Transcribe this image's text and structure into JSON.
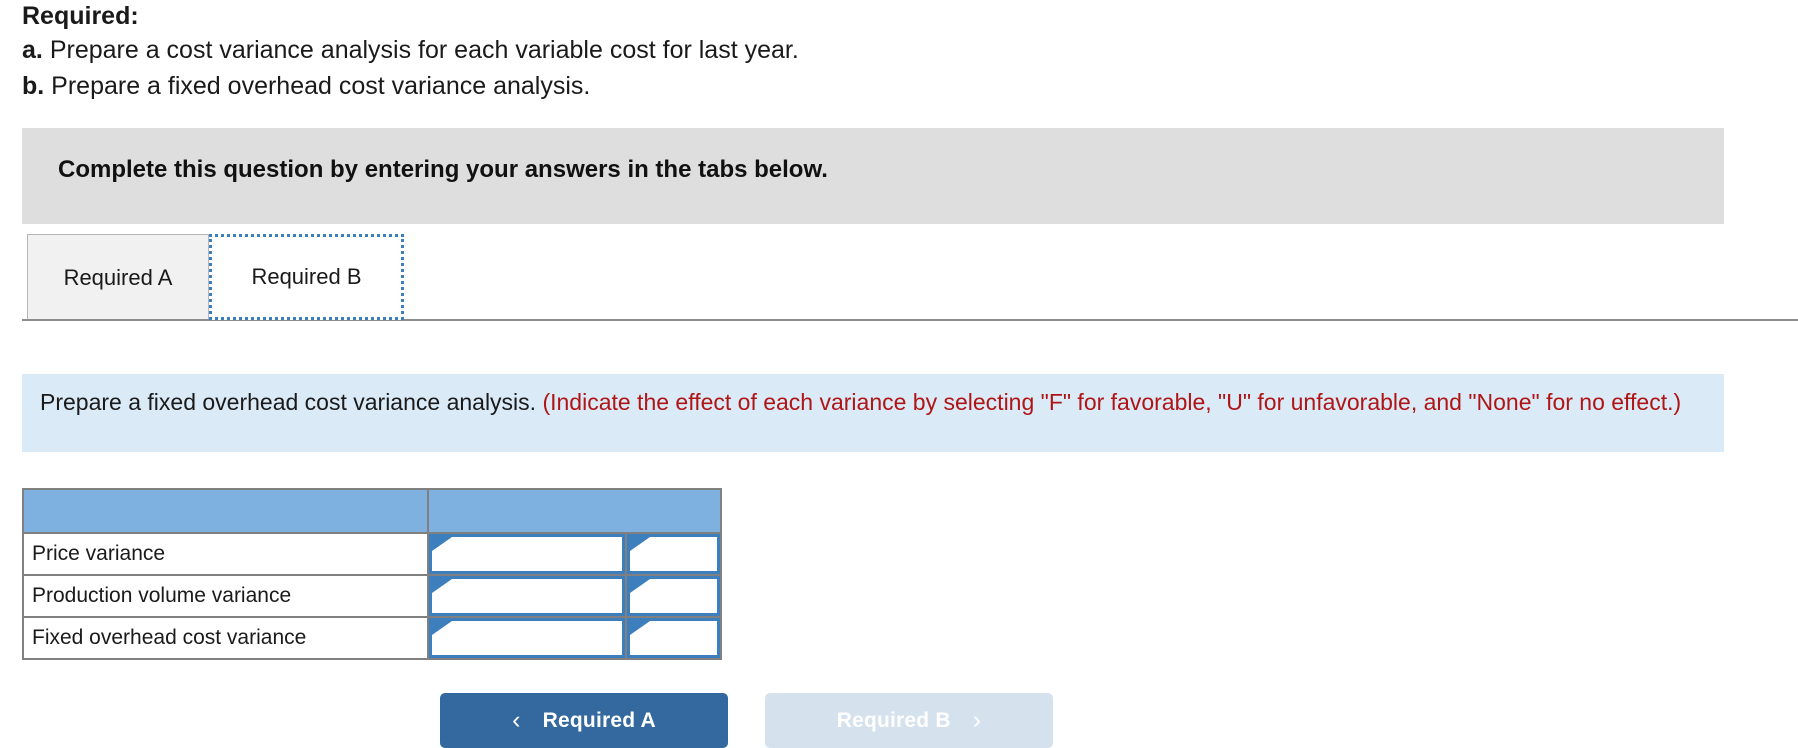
{
  "required": {
    "title": "Required:",
    "items": [
      {
        "label": "a.",
        "text": "Prepare a cost variance analysis for each variable cost for last year."
      },
      {
        "label": "b.",
        "text": "Prepare a fixed overhead cost variance analysis."
      }
    ]
  },
  "banner": {
    "text": "Complete this question by entering your answers in the tabs below.",
    "background": "#dedede"
  },
  "tabs": [
    {
      "label": "Required A",
      "selected": false
    },
    {
      "label": "Required B",
      "selected": true
    }
  ],
  "prompt": {
    "main": "Prepare a fixed overhead cost variance analysis.",
    "hint": "(Indicate the effect of each variance by selecting \"F\" for favorable, \"U\" for unfavorable, and \"None\" for no effect.)",
    "background": "#daeaf7",
    "hint_color": "#b01515"
  },
  "table": {
    "header": {
      "col1": "",
      "col2": ""
    },
    "header_background": "#7eb0e0",
    "rows": [
      {
        "label": "Price variance",
        "amount": "",
        "effect": ""
      },
      {
        "label": "Production volume variance",
        "amount": "",
        "effect": ""
      },
      {
        "label": "Fixed overhead cost variance",
        "amount": "",
        "effect": ""
      }
    ]
  },
  "footer": {
    "prev": {
      "label": "Required A",
      "icon": "chevron-left",
      "glyph": "‹",
      "enabled": true,
      "color": "#33699f"
    },
    "next": {
      "label": "Required B",
      "icon": "chevron-right",
      "glyph": "›",
      "enabled": false,
      "color": "#d5e2ee"
    }
  }
}
